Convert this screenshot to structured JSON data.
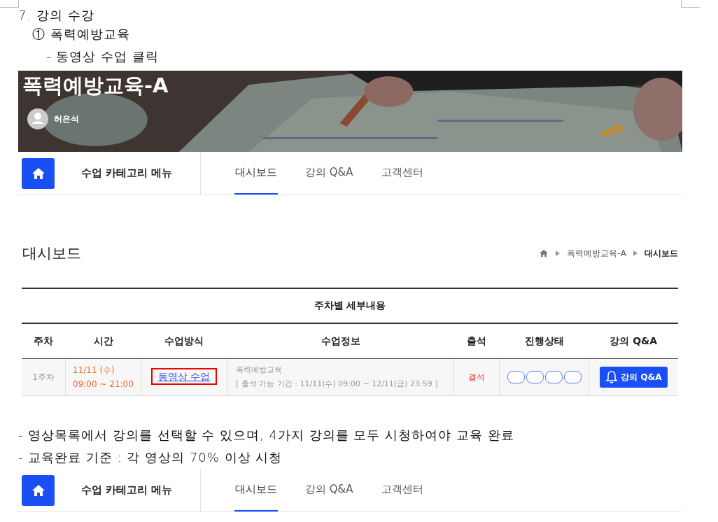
{
  "document": {
    "heading": "7. 강의 수강",
    "subheading": "① 폭력예방교육",
    "step": "- 동영상 수업 클릭"
  },
  "course_page": {
    "banner": {
      "title": "폭력예방교육-A",
      "instructor": "허은석"
    },
    "nav": {
      "menu_label": "수업 카테고리 메뉴",
      "tabs": [
        {
          "label": "대시보드",
          "selected": true
        },
        {
          "label": "강의 Q&A",
          "selected": false
        },
        {
          "label": "고객센터",
          "selected": false
        }
      ]
    },
    "page_title": "대시보드",
    "breadcrumb": [
      "폭력예방교육-A",
      "대시보드"
    ],
    "table": {
      "caption": "주차별 세부내용",
      "columns": [
        "주차",
        "시간",
        "수업방식",
        "수업정보",
        "출석",
        "진행상태",
        "강의 Q&A"
      ],
      "rows": [
        {
          "week": "1주차",
          "date": "11/11 (수)",
          "time": "09:00 ~ 21:00",
          "method": "동영상 수업",
          "highlighted": true,
          "info_title": "폭력예방교육",
          "info_period": "[ 출석 가능 기간 : 11/11(수) 09:00 ~ 12/11(금) 23:59 ]",
          "attendance": "결석",
          "progress": [
            {
              "watched": false
            },
            {
              "watched": false
            },
            {
              "watched": false
            },
            {
              "watched": false
            }
          ],
          "qa_button": "강의 Q&A"
        }
      ]
    }
  },
  "notes": [
    "- 영상목록에서 강의를 선택할 수 있으며, 4가지 강의를 모두 시청하여야 교육 완료",
    "- 교육완료 기준 : 각 영상의 70% 이상 시청"
  ],
  "second_nav": {
    "menu_label": "수업 카테고리 메뉴",
    "tabs": [
      {
        "label": "대시보드",
        "selected": true
      },
      {
        "label": "강의 Q&A",
        "selected": false
      },
      {
        "label": "고객센터",
        "selected": false
      }
    ]
  }
}
